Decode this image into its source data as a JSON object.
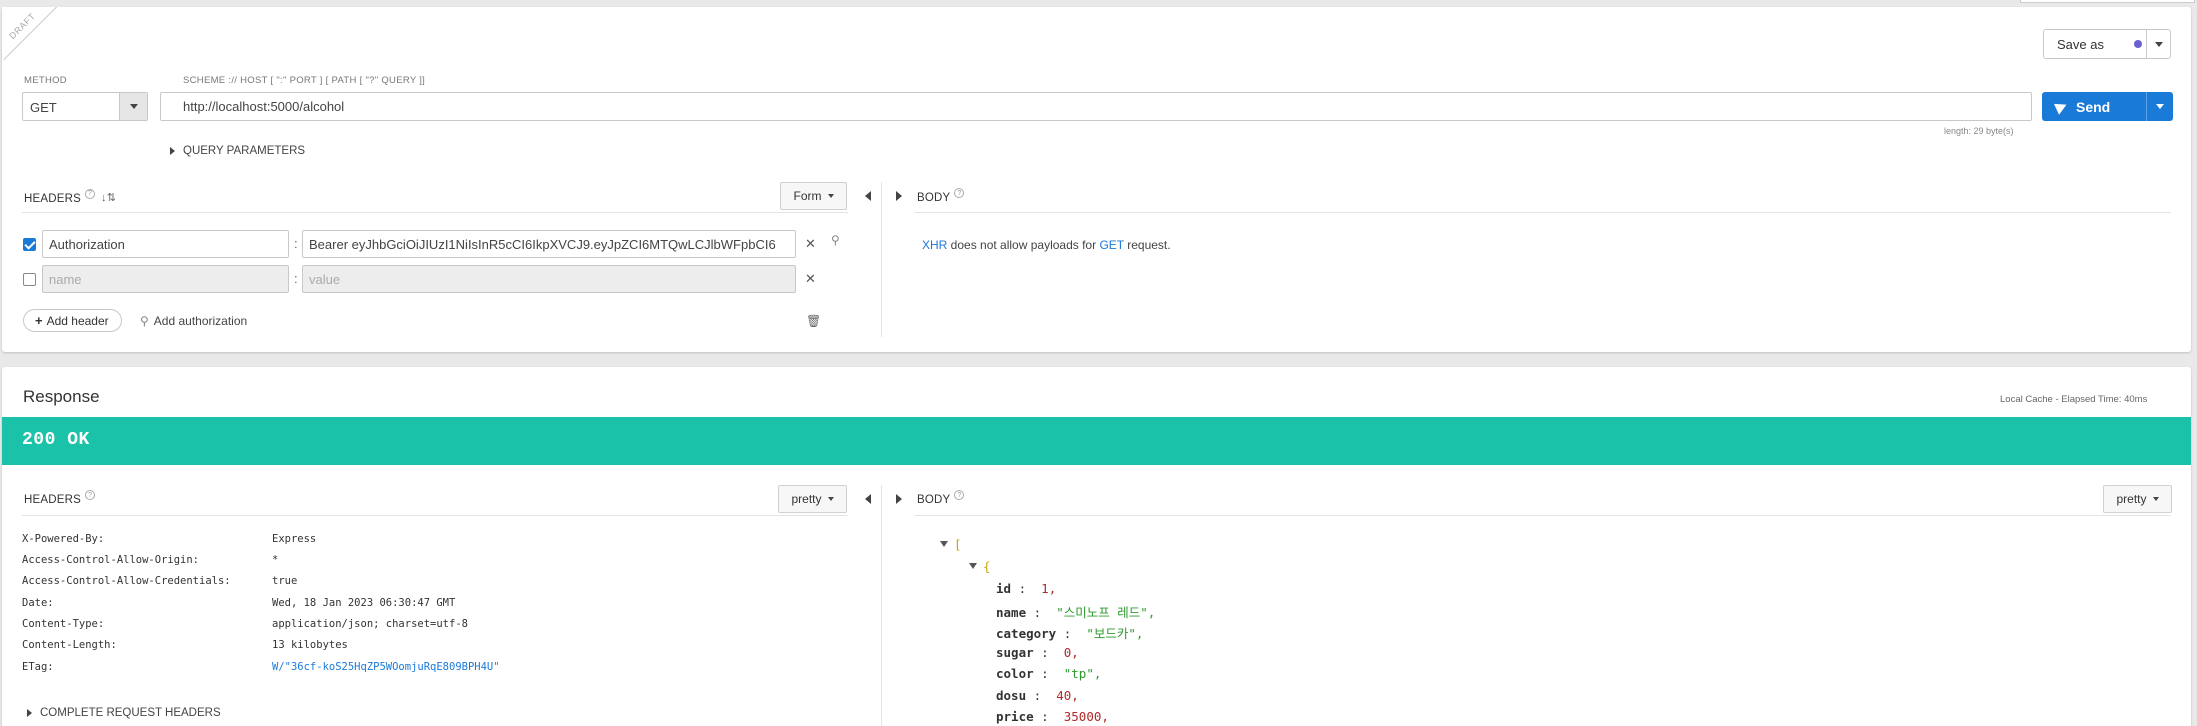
{
  "request": {
    "draft_label": "DRAFT",
    "method_label": "METHOD",
    "method_value": "GET",
    "scheme_hint": "SCHEME :// HOST [ \":\" PORT ] [ PATH [ \"?\" QUERY ]]",
    "url": "http://localhost:5000/alcohol",
    "length_note": "length: 29 byte(s)",
    "send_label": "Send",
    "save_label": "Save as",
    "query_params_label": "QUERY PARAMETERS",
    "headers_title": "HEADERS",
    "headers_mode": "Form",
    "body_title": "BODY",
    "headers": [
      {
        "enabled": true,
        "name": "Authorization",
        "value": "Bearer eyJhbGciOiJIUzI1NiIsInR5cCI6IkpXVCJ9.eyJpZCI6MTQwLCJlbWFpbCI6"
      }
    ],
    "new_header_placeholders": {
      "name": "name",
      "value": "value"
    },
    "add_header_label": "Add header",
    "add_authorization_label": "Add authorization",
    "body_message": {
      "xhr": "XHR",
      "middle": " does not allow payloads for ",
      "method": "GET",
      "end": " request."
    }
  },
  "response": {
    "title": "Response",
    "cache_note": "Local Cache - Elapsed Time: 40ms",
    "status": "200 OK",
    "status_color": "#19c2a8",
    "headers_title": "HEADERS",
    "headers_mode": "pretty",
    "body_title": "BODY",
    "body_mode": "pretty",
    "headers": [
      {
        "name": "X-Powered-By:",
        "value": "Express"
      },
      {
        "name": "Access-Control-Allow-Origin:",
        "value": "*"
      },
      {
        "name": "Access-Control-Allow-Credentials:",
        "value": "true"
      },
      {
        "name": "Date:",
        "value": "Wed, 18 Jan 2023 06:30:47 GMT"
      },
      {
        "name": "Content-Type:",
        "value": "application/json; charset=utf-8"
      },
      {
        "name": "Content-Length:",
        "value": "13 kilobytes"
      },
      {
        "name": "ETag:",
        "value": "W/\"36cf-koS25HqZP5WOomjuRqE809BPH4U\""
      }
    ],
    "complete_headers_label": "COMPLETE REQUEST HEADERS",
    "json": {
      "open_array": "[",
      "open_object": "{",
      "fields": [
        {
          "key": "id",
          "value": "1,",
          "type": "num"
        },
        {
          "key": "name",
          "value": "\"스미노프 레드\",",
          "type": "str"
        },
        {
          "key": "category",
          "value": "\"보드카\",",
          "type": "str"
        },
        {
          "key": "sugar",
          "value": "0,",
          "type": "num"
        },
        {
          "key": "color",
          "value": "\"tp\",",
          "type": "str"
        },
        {
          "key": "dosu",
          "value": "40,",
          "type": "num"
        },
        {
          "key": "price",
          "value": "35000,",
          "type": "num"
        }
      ]
    }
  }
}
